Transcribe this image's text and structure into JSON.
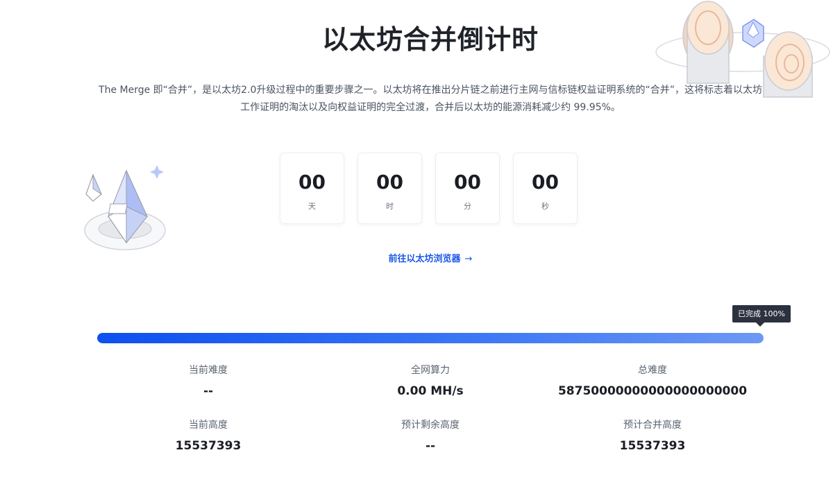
{
  "header": {
    "title": "以太坊合并倒计时",
    "description": "The Merge 即“合并”，是以太坊2.0升级过程中的重要步骤之一。以太坊将在推出分片链之前进行主网与信标链权益证明系统的“合并”，这将标志着以太坊工作证明的淘汰以及向权益证明的完全过渡，合并后以太坊的能源消耗减少约 99.95%。"
  },
  "countdown": [
    {
      "value": "00",
      "unit": "天"
    },
    {
      "value": "00",
      "unit": "时"
    },
    {
      "value": "00",
      "unit": "分"
    },
    {
      "value": "00",
      "unit": "秒"
    }
  ],
  "explorer_link": {
    "label": "前往以太坊浏览器",
    "arrow": "→"
  },
  "progress": {
    "tooltip": "已完成 100%",
    "percent": 100
  },
  "stats": [
    {
      "label": "当前难度",
      "value": "--"
    },
    {
      "label": "全网算力",
      "value": "0.00 MH/s"
    },
    {
      "label": "总难度",
      "value": "58750000000000000000000"
    },
    {
      "label": "当前高度",
      "value": "15537393"
    },
    {
      "label": "预计剩余高度",
      "value": "--"
    },
    {
      "label": "预计合并高度",
      "value": "15537393"
    }
  ],
  "colors": {
    "accent": "#1a56e8",
    "progress_start": "#0d4ff0",
    "progress_end": "#6d98f5"
  },
  "icons": [
    "ethereum-crystal-illustration",
    "merge-portal-illustration",
    "arrow-right-icon",
    "sparkle-icon"
  ]
}
